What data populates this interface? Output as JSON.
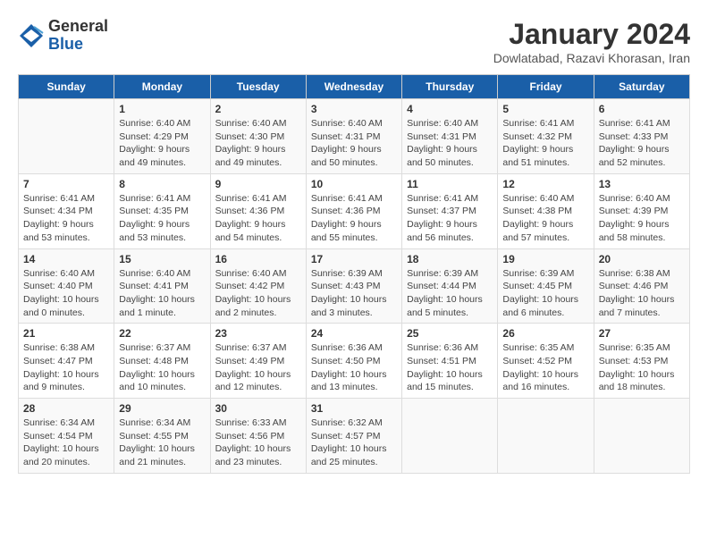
{
  "header": {
    "logo": {
      "general": "General",
      "blue": "Blue"
    },
    "title": "January 2024",
    "subtitle": "Dowlatabad, Razavi Khorasan, Iran"
  },
  "weekdays": [
    "Sunday",
    "Monday",
    "Tuesday",
    "Wednesday",
    "Thursday",
    "Friday",
    "Saturday"
  ],
  "weeks": [
    [
      {
        "day": "",
        "sunrise": "",
        "sunset": "",
        "daylight": ""
      },
      {
        "day": "1",
        "sunrise": "Sunrise: 6:40 AM",
        "sunset": "Sunset: 4:29 PM",
        "daylight": "Daylight: 9 hours and 49 minutes."
      },
      {
        "day": "2",
        "sunrise": "Sunrise: 6:40 AM",
        "sunset": "Sunset: 4:30 PM",
        "daylight": "Daylight: 9 hours and 49 minutes."
      },
      {
        "day": "3",
        "sunrise": "Sunrise: 6:40 AM",
        "sunset": "Sunset: 4:31 PM",
        "daylight": "Daylight: 9 hours and 50 minutes."
      },
      {
        "day": "4",
        "sunrise": "Sunrise: 6:40 AM",
        "sunset": "Sunset: 4:31 PM",
        "daylight": "Daylight: 9 hours and 50 minutes."
      },
      {
        "day": "5",
        "sunrise": "Sunrise: 6:41 AM",
        "sunset": "Sunset: 4:32 PM",
        "daylight": "Daylight: 9 hours and 51 minutes."
      },
      {
        "day": "6",
        "sunrise": "Sunrise: 6:41 AM",
        "sunset": "Sunset: 4:33 PM",
        "daylight": "Daylight: 9 hours and 52 minutes."
      }
    ],
    [
      {
        "day": "7",
        "sunrise": "Sunrise: 6:41 AM",
        "sunset": "Sunset: 4:34 PM",
        "daylight": "Daylight: 9 hours and 53 minutes."
      },
      {
        "day": "8",
        "sunrise": "Sunrise: 6:41 AM",
        "sunset": "Sunset: 4:35 PM",
        "daylight": "Daylight: 9 hours and 53 minutes."
      },
      {
        "day": "9",
        "sunrise": "Sunrise: 6:41 AM",
        "sunset": "Sunset: 4:36 PM",
        "daylight": "Daylight: 9 hours and 54 minutes."
      },
      {
        "day": "10",
        "sunrise": "Sunrise: 6:41 AM",
        "sunset": "Sunset: 4:36 PM",
        "daylight": "Daylight: 9 hours and 55 minutes."
      },
      {
        "day": "11",
        "sunrise": "Sunrise: 6:41 AM",
        "sunset": "Sunset: 4:37 PM",
        "daylight": "Daylight: 9 hours and 56 minutes."
      },
      {
        "day": "12",
        "sunrise": "Sunrise: 6:40 AM",
        "sunset": "Sunset: 4:38 PM",
        "daylight": "Daylight: 9 hours and 57 minutes."
      },
      {
        "day": "13",
        "sunrise": "Sunrise: 6:40 AM",
        "sunset": "Sunset: 4:39 PM",
        "daylight": "Daylight: 9 hours and 58 minutes."
      }
    ],
    [
      {
        "day": "14",
        "sunrise": "Sunrise: 6:40 AM",
        "sunset": "Sunset: 4:40 PM",
        "daylight": "Daylight: 10 hours and 0 minutes."
      },
      {
        "day": "15",
        "sunrise": "Sunrise: 6:40 AM",
        "sunset": "Sunset: 4:41 PM",
        "daylight": "Daylight: 10 hours and 1 minute."
      },
      {
        "day": "16",
        "sunrise": "Sunrise: 6:40 AM",
        "sunset": "Sunset: 4:42 PM",
        "daylight": "Daylight: 10 hours and 2 minutes."
      },
      {
        "day": "17",
        "sunrise": "Sunrise: 6:39 AM",
        "sunset": "Sunset: 4:43 PM",
        "daylight": "Daylight: 10 hours and 3 minutes."
      },
      {
        "day": "18",
        "sunrise": "Sunrise: 6:39 AM",
        "sunset": "Sunset: 4:44 PM",
        "daylight": "Daylight: 10 hours and 5 minutes."
      },
      {
        "day": "19",
        "sunrise": "Sunrise: 6:39 AM",
        "sunset": "Sunset: 4:45 PM",
        "daylight": "Daylight: 10 hours and 6 minutes."
      },
      {
        "day": "20",
        "sunrise": "Sunrise: 6:38 AM",
        "sunset": "Sunset: 4:46 PM",
        "daylight": "Daylight: 10 hours and 7 minutes."
      }
    ],
    [
      {
        "day": "21",
        "sunrise": "Sunrise: 6:38 AM",
        "sunset": "Sunset: 4:47 PM",
        "daylight": "Daylight: 10 hours and 9 minutes."
      },
      {
        "day": "22",
        "sunrise": "Sunrise: 6:37 AM",
        "sunset": "Sunset: 4:48 PM",
        "daylight": "Daylight: 10 hours and 10 minutes."
      },
      {
        "day": "23",
        "sunrise": "Sunrise: 6:37 AM",
        "sunset": "Sunset: 4:49 PM",
        "daylight": "Daylight: 10 hours and 12 minutes."
      },
      {
        "day": "24",
        "sunrise": "Sunrise: 6:36 AM",
        "sunset": "Sunset: 4:50 PM",
        "daylight": "Daylight: 10 hours and 13 minutes."
      },
      {
        "day": "25",
        "sunrise": "Sunrise: 6:36 AM",
        "sunset": "Sunset: 4:51 PM",
        "daylight": "Daylight: 10 hours and 15 minutes."
      },
      {
        "day": "26",
        "sunrise": "Sunrise: 6:35 AM",
        "sunset": "Sunset: 4:52 PM",
        "daylight": "Daylight: 10 hours and 16 minutes."
      },
      {
        "day": "27",
        "sunrise": "Sunrise: 6:35 AM",
        "sunset": "Sunset: 4:53 PM",
        "daylight": "Daylight: 10 hours and 18 minutes."
      }
    ],
    [
      {
        "day": "28",
        "sunrise": "Sunrise: 6:34 AM",
        "sunset": "Sunset: 4:54 PM",
        "daylight": "Daylight: 10 hours and 20 minutes."
      },
      {
        "day": "29",
        "sunrise": "Sunrise: 6:34 AM",
        "sunset": "Sunset: 4:55 PM",
        "daylight": "Daylight: 10 hours and 21 minutes."
      },
      {
        "day": "30",
        "sunrise": "Sunrise: 6:33 AM",
        "sunset": "Sunset: 4:56 PM",
        "daylight": "Daylight: 10 hours and 23 minutes."
      },
      {
        "day": "31",
        "sunrise": "Sunrise: 6:32 AM",
        "sunset": "Sunset: 4:57 PM",
        "daylight": "Daylight: 10 hours and 25 minutes."
      },
      {
        "day": "",
        "sunrise": "",
        "sunset": "",
        "daylight": ""
      },
      {
        "day": "",
        "sunrise": "",
        "sunset": "",
        "daylight": ""
      },
      {
        "day": "",
        "sunrise": "",
        "sunset": "",
        "daylight": ""
      }
    ]
  ]
}
